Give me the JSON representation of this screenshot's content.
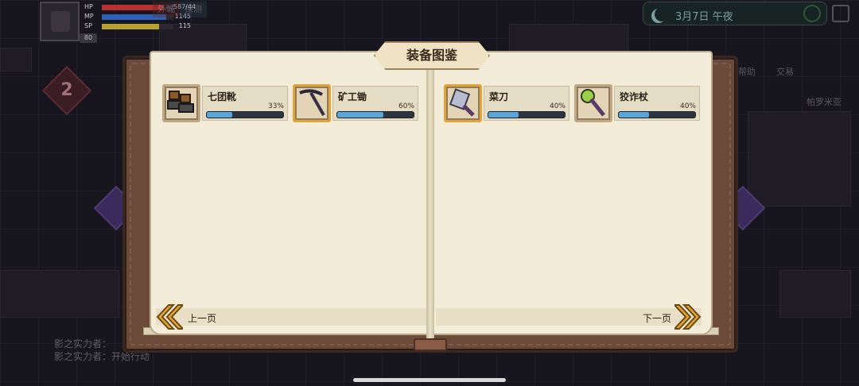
{
  "hud": {
    "hp_label": "HP",
    "hp_value": "587/44",
    "mp_label": "MP",
    "mp_value": "1145",
    "sp_label": "SP",
    "sp_value": "115",
    "level": "80",
    "tag1": "外城",
    "tag2": "探测"
  },
  "top_right": {
    "date": "3月7日 午夜"
  },
  "side": {
    "stage": "2",
    "label_a": "帕罗米亚",
    "label_b": "交易",
    "label_c": "帮助"
  },
  "chat": [
    "影之实力者：",
    "影之实力者：开始行动"
  ],
  "book": {
    "title": "装备图鉴",
    "prev_label": "上一页",
    "next_label": "下一页"
  },
  "items": [
    {
      "name": "七团靴",
      "progress_text": "33%",
      "progress": 0.33,
      "icon": "boots-icon"
    },
    {
      "name": "矿工锄",
      "progress_text": "60%",
      "progress": 0.6,
      "icon": "pickaxe-icon"
    },
    {
      "name": "菜刀",
      "progress_text": "40%",
      "progress": 0.4,
      "icon": "cleaver-icon"
    },
    {
      "name": "狡诈杖",
      "progress_text": "40%",
      "progress": 0.4,
      "icon": "staff-icon"
    }
  ],
  "colors": {
    "page": "#f2ecd8",
    "frame": "#6b4a3a",
    "progress_fill": "#5aa6d8",
    "chevron": "#e0a43a"
  }
}
